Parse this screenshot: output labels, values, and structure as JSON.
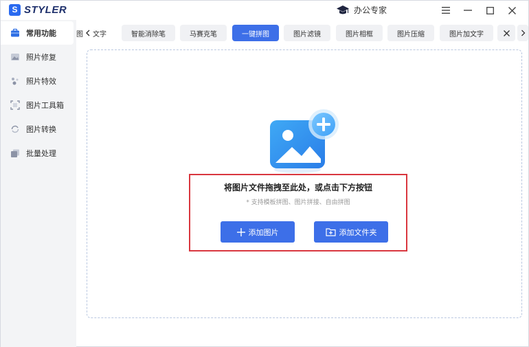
{
  "app": {
    "logo_mark": "S",
    "logo_text": "STYLER",
    "title": "办公专家"
  },
  "sidebar": {
    "items": [
      {
        "label": "常用功能",
        "icon": "briefcase-icon",
        "active": true
      },
      {
        "label": "照片修复",
        "icon": "photo-repair-icon",
        "active": false
      },
      {
        "label": "照片特效",
        "icon": "sparkle-icon",
        "active": false
      },
      {
        "label": "图片工具箱",
        "icon": "crop-frame-icon",
        "active": false
      },
      {
        "label": "图片转换",
        "icon": "convert-icon",
        "active": false
      },
      {
        "label": "批量处理",
        "icon": "batch-icon",
        "active": false
      }
    ]
  },
  "tabs": {
    "partial_left": "图",
    "items": [
      {
        "label": "文字",
        "active": false
      },
      {
        "label": "智能消除笔",
        "active": false
      },
      {
        "label": "马赛克笔",
        "active": false
      },
      {
        "label": "一键拼图",
        "active": true
      },
      {
        "label": "图片滤镜",
        "active": false
      },
      {
        "label": "图片相框",
        "active": false
      },
      {
        "label": "图片压缩",
        "active": false
      },
      {
        "label": "图片加文字",
        "active": false
      }
    ]
  },
  "dropzone": {
    "title": "将图片文件拖拽至此处，或点击下方按钮",
    "subtitle": "* 支持模板拼图、图片拼接、自由拼图",
    "add_image_label": "添加图片",
    "add_folder_label": "添加文件夹"
  },
  "colors": {
    "accent": "#3d6fe8",
    "highlight_border": "#d9363e",
    "sidebar_bg": "#f3f4f6"
  }
}
